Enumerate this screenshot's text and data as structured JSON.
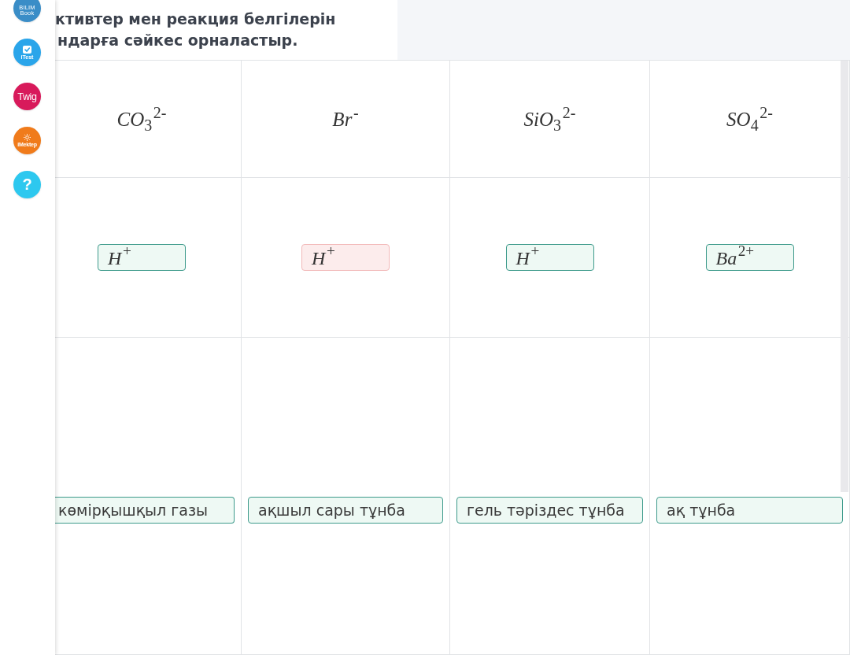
{
  "sidebar": {
    "items": [
      {
        "kind": "bilimbook",
        "label": "BILIM Book"
      },
      {
        "kind": "itest",
        "label": "iTest"
      },
      {
        "kind": "twig",
        "label": "Twig"
      },
      {
        "kind": "imektep",
        "label": "iMektep"
      },
      {
        "kind": "help",
        "label": "?"
      }
    ]
  },
  "question": {
    "lines": [
      "ктивтер мен реакция белгілерін",
      "ндарға сәйкес орналастыр."
    ]
  },
  "table": {
    "headers": [
      "CO$_{3}$$^{2-}$",
      "Br$^{-}$",
      "SiO$_{3}$$^{2-}$",
      "SO$_{4}$$^{2-}$"
    ],
    "rows": [
      {
        "kind": "reagent",
        "cells": [
          {
            "text": "H$^{+}$",
            "correct": true
          },
          {
            "text": "H$^{+}$",
            "correct": false
          },
          {
            "text": "H$^{+}$",
            "correct": true
          },
          {
            "text": "Ba$^{2+}$",
            "correct": true
          }
        ]
      },
      {
        "kind": "result",
        "cells": [
          {
            "text": "көмірқышқыл газы",
            "correct": true
          },
          {
            "text": "ақшыл сары тұнба",
            "correct": true
          },
          {
            "text": "гель тәріздес тұнба",
            "correct": true
          },
          {
            "text": "ақ тұнба",
            "correct": true
          }
        ]
      }
    ]
  }
}
